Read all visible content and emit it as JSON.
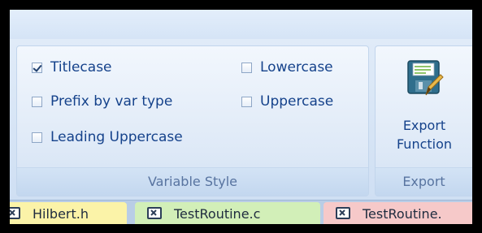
{
  "variable_style": {
    "caption": "Variable Style",
    "options": {
      "titlecase": {
        "label": "Titlecase",
        "checked": true
      },
      "prefix": {
        "label": "Prefix by var type",
        "checked": false
      },
      "leading_uppercase": {
        "label": "Leading Uppercase",
        "checked": false
      },
      "lowercase": {
        "label": "Lowercase",
        "checked": false
      },
      "uppercase": {
        "label": "Uppercase",
        "checked": false
      }
    }
  },
  "export": {
    "caption": "Export",
    "button_label": "Export\nFunction",
    "icon": "floppy-disk-pencil-icon"
  },
  "doc_tabs": [
    {
      "label": "Hilbert.h",
      "color": "#fbf3a8"
    },
    {
      "label": "TestRoutine.c",
      "color": "#d2efb8"
    },
    {
      "label": "TestRoutine.",
      "color": "#f6c9c9"
    }
  ],
  "colors": {
    "text": "#15428b",
    "caption_text": "#5874a0"
  }
}
